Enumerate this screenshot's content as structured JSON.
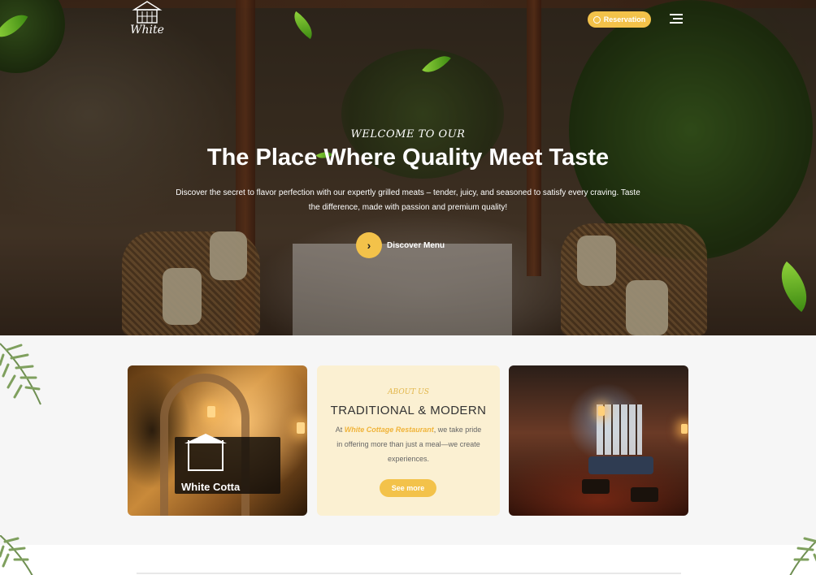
{
  "header": {
    "logo_text": "White",
    "reservation_label": "Reservation"
  },
  "hero": {
    "welcome": "WELCOME TO OUR",
    "title": "The Place Where Quality Meet Taste",
    "description": "Discover the secret to flavor perfection with our expertly grilled meats – tender, juicy, and seasoned to satisfy every craving. Taste the difference, made with passion and premium quality!",
    "cta_label": "Discover Menu"
  },
  "about": {
    "eyebrow": "ABOUT US",
    "title": "TRADITIONAL & MODERN",
    "desc_prefix": "At ",
    "brand": "White Cottage Restaurant",
    "desc_suffix": ", we take pride in offering more than just a meal—we create experiences.",
    "button_label": "See more",
    "sign_text": "White Cotta"
  },
  "colors": {
    "accent": "#f3c24a",
    "about_card_bg": "#fbf0d2"
  }
}
